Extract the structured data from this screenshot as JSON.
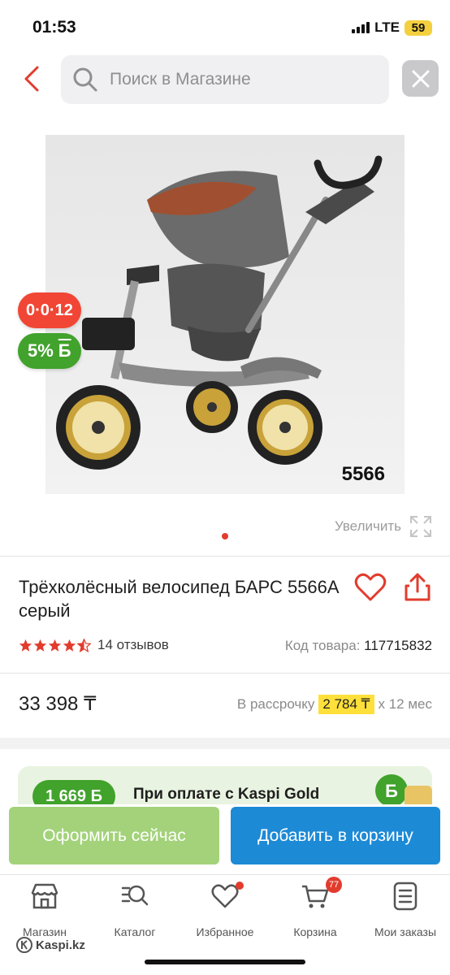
{
  "status_bar": {
    "time": "01:53",
    "network": "LTE",
    "battery": "59"
  },
  "search": {
    "placeholder": "Поиск в Магазине"
  },
  "product": {
    "model_number": "5566",
    "badge_installment": "0·0·12",
    "badge_bonus": "5%",
    "bonus_currency": "Б",
    "zoom_label": "Увеличить",
    "title": "Трёхколёсный велосипед БАРС 5566А серый",
    "rating": 4.5,
    "reviews": "14 отзывов",
    "sku_label": "Код товара:",
    "sku_value": "117715832",
    "price": "33 398 ₸",
    "installment_label": "В рассрочку",
    "installment_amount": "2 784 ₸",
    "installment_term": "х 12 мес"
  },
  "promo": {
    "bonus_amount": "1 669 Б",
    "text": "При оплате с Kaspi Gold"
  },
  "actions": {
    "buy_now": "Оформить сейчас",
    "add_to_cart": "Добавить в корзину"
  },
  "tabs": [
    {
      "label": "Магазин",
      "icon": "store-icon"
    },
    {
      "label": "Каталог",
      "icon": "catalog-search-icon"
    },
    {
      "label": "Избранное",
      "icon": "heart-icon"
    },
    {
      "label": "Корзина",
      "icon": "cart-icon",
      "badge": "77"
    },
    {
      "label": "Мои заказы",
      "icon": "orders-icon"
    }
  ],
  "footer": {
    "site": "Kaspi.kz"
  },
  "colors": {
    "accent_red": "#e23c2e",
    "green": "#41a22c",
    "blue": "#1d8ad6",
    "yellow": "#ffe03a"
  }
}
